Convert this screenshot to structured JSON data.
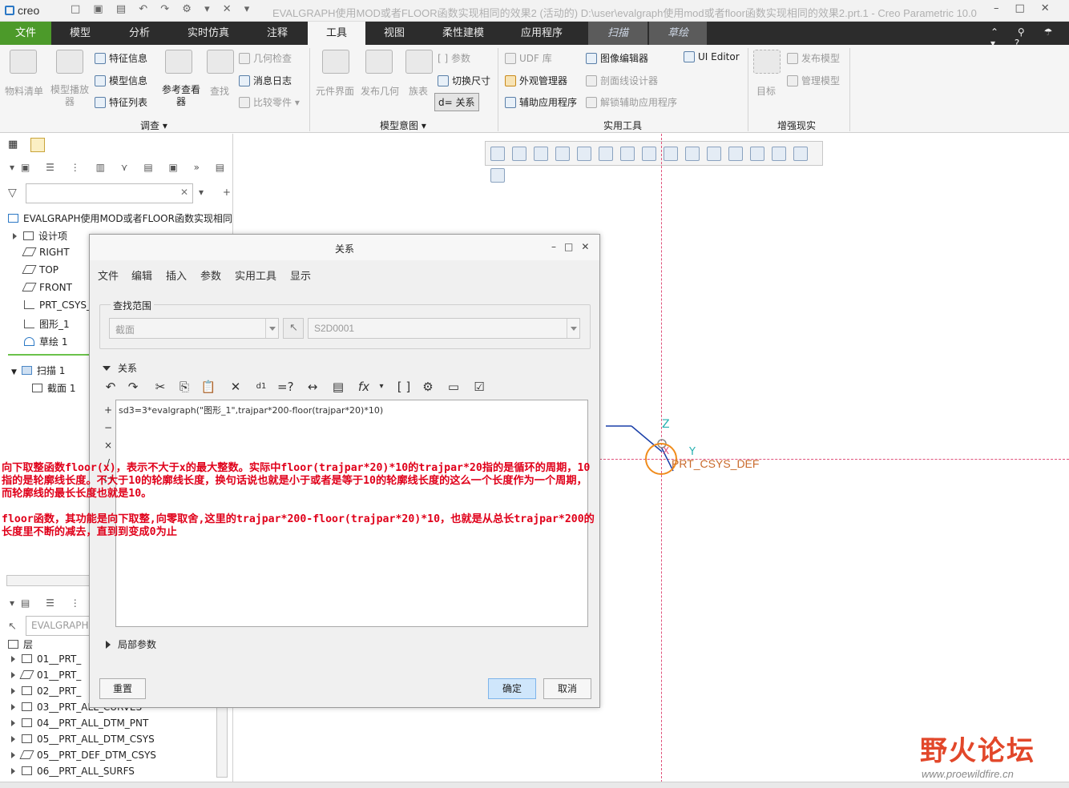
{
  "titlebar": {
    "logo": "creo",
    "title": "EVALGRAPH使用MOD或者FLOOR函数实现相同的效果2 (活动的) D:\\user\\evalgraph使用mod或者floor函数实现相同的效果2.prt.1 - Creo Parametric 10.0"
  },
  "tabs": [
    "文件",
    "模型",
    "分析",
    "实时仿真",
    "注释",
    "工具",
    "视图",
    "柔性建模",
    "应用程序",
    "扫描",
    "草绘"
  ],
  "ribbon": {
    "left_big": [
      "物料清单",
      "模型播放器"
    ],
    "info": [
      "特征信息",
      "模型信息",
      "特征列表"
    ],
    "ref": [
      "参考查看器",
      "查找"
    ],
    "check": [
      "几何检查",
      "消息日志",
      "比较零件"
    ],
    "group_investigate": "调查",
    "intent_big": [
      "元件界面",
      "发布几何",
      "族表"
    ],
    "intent_small": [
      "参数",
      "切换尺寸",
      "关系"
    ],
    "group_intent": "模型意图",
    "util_a": [
      "UDF 库",
      "外观管理器",
      "辅助应用程序"
    ],
    "util_b": [
      "图像编辑器",
      "剖面线设计器",
      "解锁辅助应用程序"
    ],
    "util_c": "UI Editor",
    "group_util": "实用工具",
    "ar_big": "目标",
    "ar_small": [
      "发布模型",
      "管理模型"
    ],
    "group_ar": "增强现实"
  },
  "tree": {
    "root": "EVALGRAPH使用MOD或者FLOOR函数实现相同",
    "items": [
      "设计项",
      "RIGHT",
      "TOP",
      "FRONT",
      "PRT_CSYS_",
      "图形_1",
      "草绘 1",
      "扫描 1",
      "截面 1"
    ]
  },
  "layers": {
    "search": "EVALGRAPH",
    "header": "层",
    "items": [
      "01__PRT_",
      "01__PRT_",
      "02__PRT_",
      "03__PRT_ALL_CURVES",
      "04__PRT_ALL_DTM_PNT",
      "05__PRT_ALL_DTM_CSYS",
      "05__PRT_DEF_DTM_CSYS",
      "06__PRT_ALL_SURFS"
    ]
  },
  "dialog": {
    "title": "关系",
    "menu": [
      "文件",
      "编辑",
      "插入",
      "参数",
      "实用工具",
      "显示"
    ],
    "scope_label": "查找范围",
    "scope_type": "截面",
    "scope_item": "S2D0001",
    "relations_header": "关系",
    "ops": [
      "+",
      "−",
      "×",
      "/",
      "[ ]"
    ],
    "code": "sd3=3*evalgraph(\"图形_1\",trajpar*200-floor(trajpar*20)*10)",
    "local_params": "局部参数",
    "reset": "重置",
    "ok": "确定",
    "cancel": "取消"
  },
  "graphics": {
    "csys_label": "PRT_CSYS_DEF",
    "z_label": "Z",
    "y_label": "Y",
    "x_label": "X"
  },
  "annotation": [
    "向下取整函数floor(x)，表示不大于x的最大整数。实际中floor(trajpar*20)*10的trajpar*20指的是循环的周期，10指的是轮廓线长度。不大于10的轮廓线长度，换句话说也就是小于或者是等于10的轮廓线长度的这么一个长度作为一个周期，而轮廓线的最长长度也就是10。",
    "floor函数，其功能是向下取整,向零取舍,这里的trajpar*200-floor(trajpar*20)*10，也就是从总长trajpar*200的长度里不断的减去，直到到变成0为止"
  ],
  "watermark": {
    "text": "野火论坛",
    "url": "www.proewildfire.cn"
  },
  "colors": {
    "file_tab": "#4c9a2a",
    "annotation": "#e0001a",
    "datum": "#e0507a",
    "csys": "#f08c1c"
  }
}
